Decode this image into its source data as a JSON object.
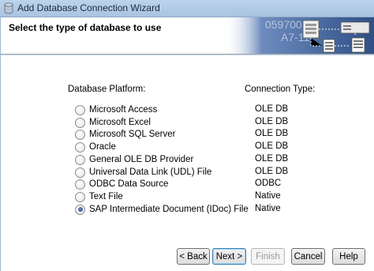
{
  "window": {
    "title": "Add Database Connection Wizard"
  },
  "header": {
    "title": "Select the type of database to use",
    "banner_text_1": "0597001",
    "banner_text_2": "A7-11"
  },
  "columns": {
    "platform_label": "Database Platform:",
    "connection_label": "Connection Type:"
  },
  "options": [
    {
      "label": "Microsoft Access",
      "connection": "OLE DB",
      "selected": false
    },
    {
      "label": "Microsoft Excel",
      "connection": "OLE DB",
      "selected": false
    },
    {
      "label": "Microsoft SQL Server",
      "connection": "OLE DB",
      "selected": false
    },
    {
      "label": "Oracle",
      "connection": "OLE DB",
      "selected": false
    },
    {
      "label": "General OLE DB Provider",
      "connection": "OLE DB",
      "selected": false
    },
    {
      "label": "Universal Data Link (UDL) File",
      "connection": "OLE DB",
      "selected": false
    },
    {
      "label": "ODBC Data Source",
      "connection": "ODBC",
      "selected": false
    },
    {
      "label": "Text File",
      "connection": "Native",
      "selected": false
    },
    {
      "label": "SAP Intermediate Document (IDoc) File",
      "connection": "Native",
      "selected": true
    }
  ],
  "buttons": {
    "back": "< Back",
    "next": "Next >",
    "finish": "Finish",
    "cancel": "Cancel",
    "help": "Help"
  },
  "colors": {
    "selected_radio": "#1f3f86",
    "title_bar": "#bcd3ec",
    "banner": "#3b5f9a"
  }
}
